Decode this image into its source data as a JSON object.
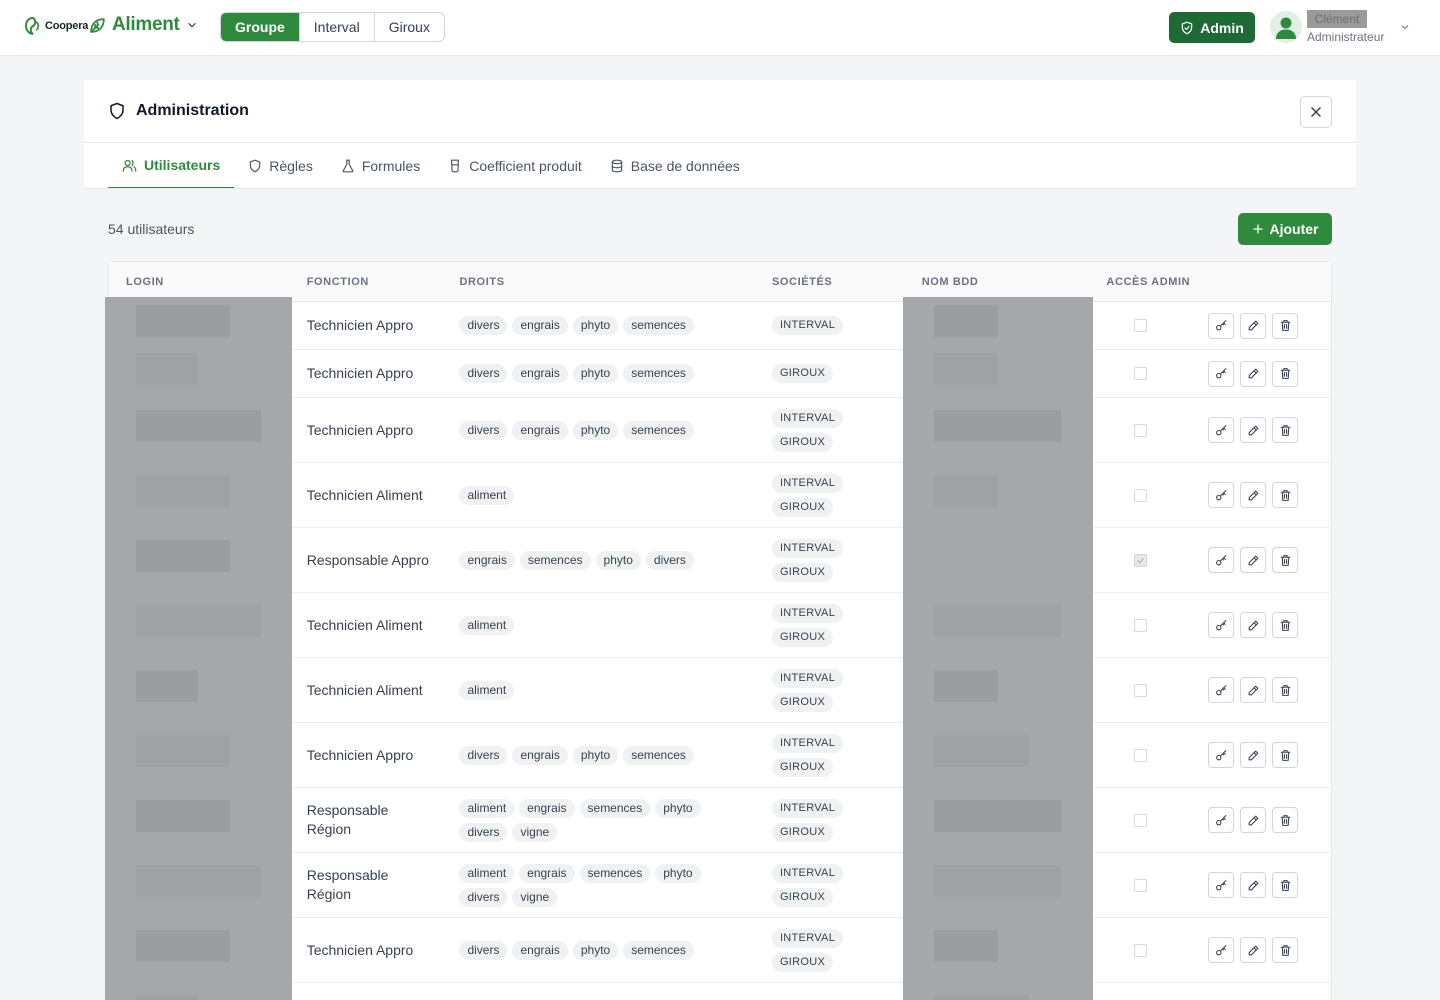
{
  "topbar": {
    "logo_text": "Coopera",
    "app_name": "Aliment",
    "segments": [
      {
        "label": "Groupe",
        "active": true
      },
      {
        "label": "Interval",
        "active": false
      },
      {
        "label": "Giroux",
        "active": false
      }
    ],
    "admin_label": "Admin",
    "user_name": "Clément",
    "user_role": "Administrateur"
  },
  "panel": {
    "title": "Administration",
    "tabs": [
      {
        "label": "Utilisateurs",
        "icon": "users-icon",
        "active": true
      },
      {
        "label": "Règles",
        "icon": "shield-icon",
        "active": false
      },
      {
        "label": "Formules",
        "icon": "flask-icon",
        "active": false
      },
      {
        "label": "Coefficient produit",
        "icon": "glass-icon",
        "active": false
      },
      {
        "label": "Base de données",
        "icon": "database-icon",
        "active": false
      }
    ],
    "count_label": "54 utilisateurs",
    "add_label": "Ajouter"
  },
  "table": {
    "headers": {
      "login": "LOGIN",
      "fonction": "FONCTION",
      "droits": "DROITS",
      "societes": "SOCIÉTÉS",
      "nom_bdd": "NOM BDD",
      "acces_admin": "ACCÈS ADMIN"
    },
    "rows": [
      {
        "fonction": "Technicien Appro",
        "droits": [
          "divers",
          "engrais",
          "phyto",
          "semences"
        ],
        "societes": [
          "INTERVAL"
        ],
        "admin": false
      },
      {
        "fonction": "Technicien Appro",
        "droits": [
          "divers",
          "engrais",
          "phyto",
          "semences"
        ],
        "societes": [
          "GIROUX"
        ],
        "admin": false
      },
      {
        "fonction": "Technicien Appro",
        "droits": [
          "divers",
          "engrais",
          "phyto",
          "semences"
        ],
        "societes": [
          "INTERVAL",
          "GIROUX"
        ],
        "admin": false
      },
      {
        "fonction": "Technicien Aliment",
        "droits": [
          "aliment"
        ],
        "societes": [
          "INTERVAL",
          "GIROUX"
        ],
        "admin": false
      },
      {
        "fonction": "Responsable Appro",
        "droits": [
          "engrais",
          "semences",
          "phyto",
          "divers"
        ],
        "societes": [
          "INTERVAL",
          "GIROUX"
        ],
        "admin": true
      },
      {
        "fonction": "Technicien Aliment",
        "droits": [
          "aliment"
        ],
        "societes": [
          "INTERVAL",
          "GIROUX"
        ],
        "admin": false
      },
      {
        "fonction": "Technicien Aliment",
        "droits": [
          "aliment"
        ],
        "societes": [
          "INTERVAL",
          "GIROUX"
        ],
        "admin": false
      },
      {
        "fonction": "Technicien Appro",
        "droits": [
          "divers",
          "engrais",
          "phyto",
          "semences"
        ],
        "societes": [
          "INTERVAL",
          "GIROUX"
        ],
        "admin": false
      },
      {
        "fonction": "Responsable Région",
        "droits": [
          "aliment",
          "engrais",
          "semences",
          "phyto",
          "divers",
          "vigne"
        ],
        "societes": [
          "INTERVAL",
          "GIROUX"
        ],
        "admin": false
      },
      {
        "fonction": "Responsable Région",
        "droits": [
          "aliment",
          "engrais",
          "semences",
          "phyto",
          "divers",
          "vigne"
        ],
        "societes": [
          "INTERVAL",
          "GIROUX"
        ],
        "admin": false
      },
      {
        "fonction": "Technicien Appro",
        "droits": [
          "divers",
          "engrais",
          "phyto",
          "semences"
        ],
        "societes": [
          "INTERVAL",
          "GIROUX"
        ],
        "admin": false
      },
      {
        "fonction": "",
        "droits": [],
        "societes": [],
        "admin": false
      }
    ]
  },
  "colors": {
    "brand_green": "#2f8a3e",
    "admin_green": "#1e6a34",
    "redaction_gray": "#a6a7aa"
  }
}
